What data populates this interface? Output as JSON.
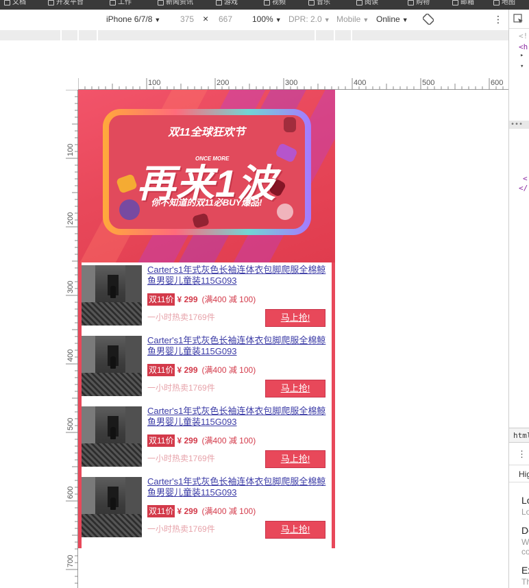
{
  "browser_bar": {
    "items": [
      "文档",
      "开发平台",
      "工作",
      "新闻资讯",
      "游戏",
      "视频",
      "音乐",
      "阅读",
      "购物",
      "邮箱",
      "地图"
    ]
  },
  "device_toolbar": {
    "device": "iPhone 6/7/8",
    "width": "375",
    "times": "×",
    "height": "667",
    "zoom": "100%",
    "dpr": "DPR: 2.0",
    "mode": "Mobile",
    "network": "Online",
    "more": "⋮"
  },
  "ruler_h": [
    "100",
    "200",
    "300",
    "400",
    "500",
    "600"
  ],
  "ruler_v": [
    "100",
    "200",
    "300",
    "400",
    "500",
    "600",
    "700"
  ],
  "banner": {
    "top": "双11全球狂欢节",
    "once_more": "ONCE MORE",
    "main": "再来1波",
    "sub": "你不知道的双11必BUY爆品!"
  },
  "products": [
    {
      "title": "Carter's1年式灰色长袖连体衣包脚爬服全棉鲸鱼男婴儿童装115G093",
      "tag": "双11价",
      "price": "¥ 299",
      "promo": "(满400 减 100)",
      "sold": "一小时热卖1769件",
      "buy": "马上抢!"
    },
    {
      "title": "Carter's1年式灰色长袖连体衣包脚爬服全棉鲸鱼男婴儿童装115G093",
      "tag": "双11价",
      "price": "¥ 299",
      "promo": "(满400 减 100)",
      "sold": "一小时热卖1769件",
      "buy": "马上抢!"
    },
    {
      "title": "Carter's1年式灰色长袖连体衣包脚爬服全棉鲸鱼男婴儿童装115G093",
      "tag": "双11价",
      "price": "¥ 299",
      "promo": "(满400 减 100)",
      "sold": "一小时热卖1769件",
      "buy": "马上抢!"
    },
    {
      "title": "Carter's1年式灰色长袖连体衣包脚爬服全棉鲸鱼男婴儿童装115G093",
      "tag": "双11价",
      "price": "¥ 299",
      "promo": "(满400 减 100)",
      "sold": "一小时热卖1769件",
      "buy": "马上抢!"
    }
  ],
  "devtools_side": {
    "lines": [
      "<!",
      "<h",
      "▸",
      "▾",
      "<",
      "</",
      "html",
      "⋮",
      "Hig",
      "Lo",
      "Lo",
      "De",
      "W",
      "co",
      "Ex",
      "Th"
    ]
  },
  "colors": {
    "brand": "#e8485a",
    "price": "#d33a4a",
    "link": "#3b3ba6",
    "sold": "#e7a3aa"
  }
}
